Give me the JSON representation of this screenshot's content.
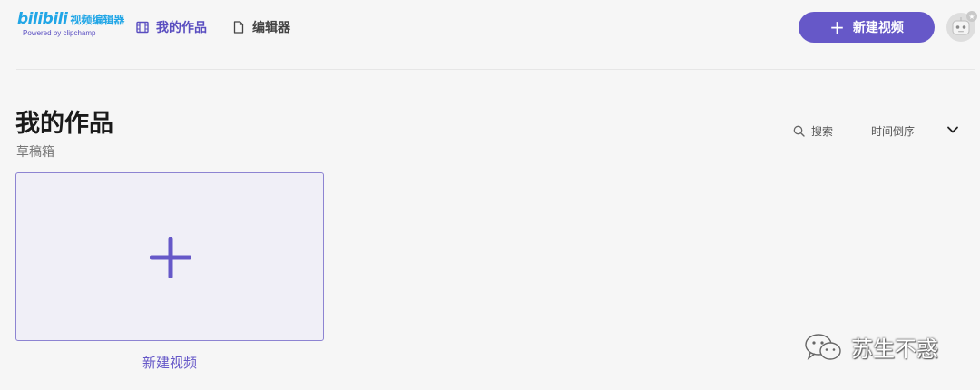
{
  "header": {
    "logo": {
      "brand": "bilibili",
      "name": "视频编辑器",
      "tagline": "Powered by clipchamp",
      "color": "#21a6e6"
    },
    "nav": [
      {
        "label": "我的作品",
        "icon": "film-icon",
        "active": true
      },
      {
        "label": "编辑器",
        "icon": "document-icon",
        "active": false
      }
    ],
    "new_video_button": {
      "label": "新建视频",
      "icon": "plus-icon",
      "color": "#6658c8"
    },
    "avatar": {
      "icon": "robot-avatar-icon"
    }
  },
  "main": {
    "title": "我的作品",
    "subtitle": "草稿箱",
    "search": {
      "label": "搜索",
      "icon": "search-icon"
    },
    "sort": {
      "label": "时间倒序",
      "icon": "chevron-down-icon"
    },
    "new_card": {
      "label": "新建视频",
      "icon": "plus-icon"
    }
  },
  "watermark": {
    "text": "苏生不惑",
    "icon": "wechat-icon"
  },
  "colors": {
    "accent": "#6658c8",
    "brand_blue": "#21a6e6",
    "background": "#f6f6f6"
  }
}
